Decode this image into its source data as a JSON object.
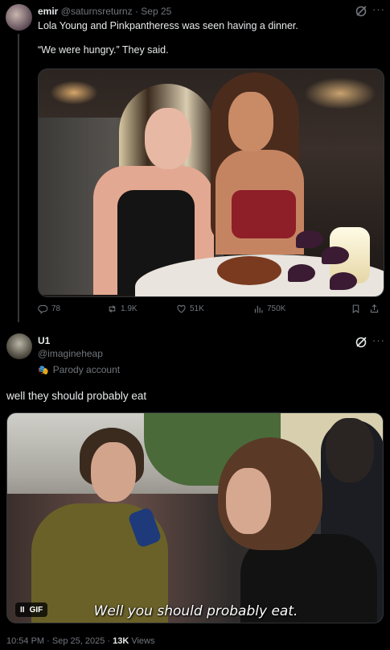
{
  "tweet1": {
    "display_name": "emir",
    "handle": "@saturnsreturnz",
    "separator": "·",
    "date": "Sep 25",
    "line1": "Lola Young and Pinkpantheress was seen having a dinner.",
    "line2": "“We were hungry.”  They said.",
    "more": "···",
    "stats": {
      "replies": "78",
      "reposts": "1.9K",
      "likes": "51K",
      "views": "750K"
    }
  },
  "tweet2": {
    "display_name": "U1",
    "handle": "@imagineheap",
    "label": "Parody account",
    "more": "···",
    "text": "well they should probably eat",
    "gif_caption": "Well you should probably eat.",
    "gif_badge": "GIF",
    "pause_glyph": "II"
  },
  "meta": {
    "time": "10:54 PM · Sep 25, 2025 ·",
    "views_count": "13K",
    "views_label": "Views"
  },
  "colors": {
    "background": "#000000",
    "text": "#e7e9ea",
    "muted": "#71767b",
    "divider": "#2f3336"
  },
  "icons": [
    "grok-icon",
    "more-icon",
    "reply-icon",
    "repost-icon",
    "like-icon",
    "views-icon",
    "bookmark-icon",
    "share-icon",
    "parody-mask-icon"
  ]
}
